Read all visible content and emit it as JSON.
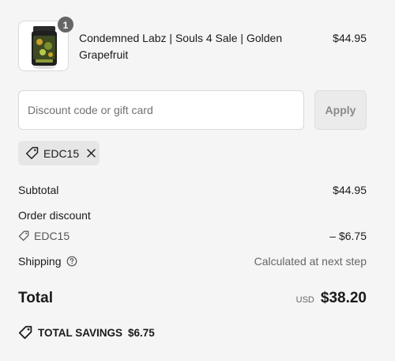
{
  "line_item": {
    "quantity": "1",
    "title": "Condemned Labz | Souls 4 Sale | Golden Grapefruit",
    "price": "$44.95"
  },
  "discount": {
    "placeholder": "Discount code or gift card",
    "value": "",
    "apply_label": "Apply",
    "applied_code": "EDC15"
  },
  "summary": {
    "subtotal_label": "Subtotal",
    "subtotal_value": "$44.95",
    "order_discount_label": "Order discount",
    "discount_code": "EDC15",
    "discount_value": "– $6.75",
    "shipping_label": "Shipping",
    "shipping_value": "Calculated at next step"
  },
  "total": {
    "label": "Total",
    "currency": "USD",
    "amount": "$38.20"
  },
  "savings": {
    "label": "TOTAL SAVINGS",
    "amount": "$6.75"
  },
  "icons": {
    "tag": "tag-icon",
    "close": "close-icon",
    "help": "question-circle-icon"
  },
  "colors": {
    "background": "#f5f5f5",
    "badge": "#666666",
    "text": "#1a1a1a",
    "muted": "#666666"
  }
}
